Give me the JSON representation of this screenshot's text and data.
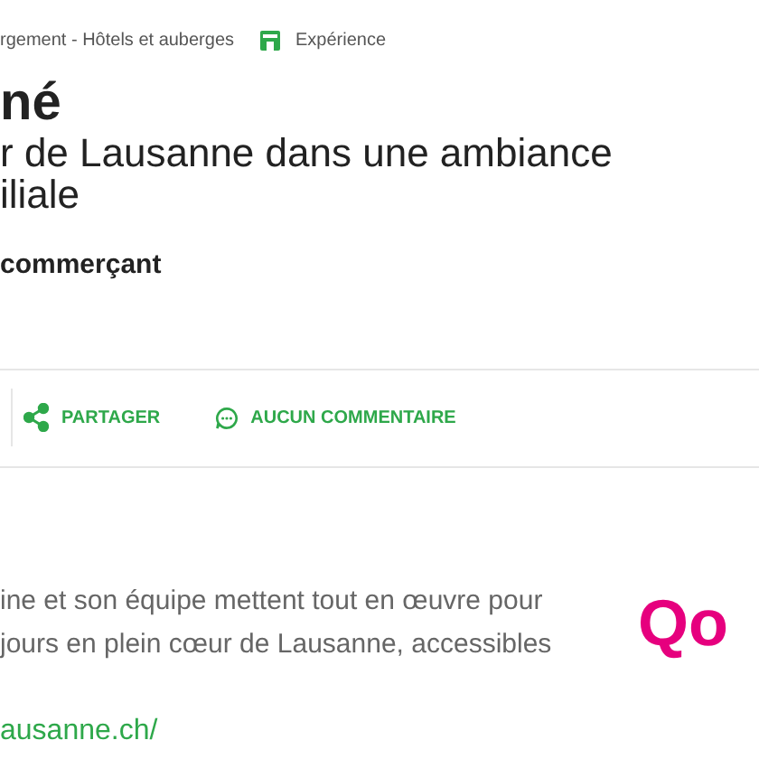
{
  "meta": {
    "category": "rgement - Hôtels et auberges",
    "tag": "Expérience"
  },
  "title": "né",
  "subtitle": "r de Lausanne dans une ambiance\niliale",
  "author_line": "commerçant",
  "actions": [
    {
      "kind": "share",
      "label": "PARTAGER"
    },
    {
      "kind": "comment",
      "label": "AUCUN COMMENTAIRE"
    }
  ],
  "body": [
    "ine et son équipe mettent tout en œuvre pour",
    "jours en plein cœur de Lausanne, accessibles"
  ],
  "logo": "Qo",
  "link": "ausanne.ch/"
}
